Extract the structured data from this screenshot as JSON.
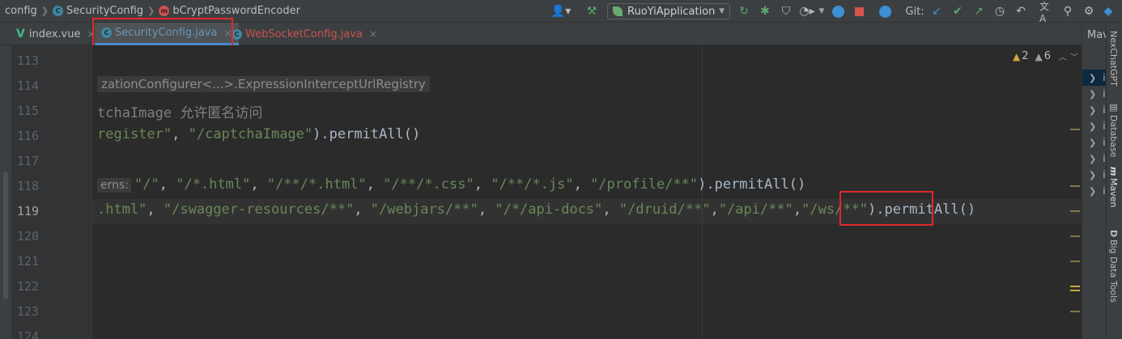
{
  "breadcrumb": {
    "items": [
      "config",
      "SecurityConfig",
      "bCryptPasswordEncoder"
    ]
  },
  "toolbar": {
    "run_config": "RuoYiApplication",
    "git_label": "Git:"
  },
  "tabs": [
    {
      "label": "index.vue",
      "icon": "vue-icon",
      "active": false,
      "color": "#bbbbbb"
    },
    {
      "label": "SecurityConfig.java",
      "icon": "class-icon",
      "active": true,
      "color": "#6897bb"
    },
    {
      "label": "WebSocketConfig.java",
      "icon": "class-icon",
      "active": false,
      "color": "#c75450"
    }
  ],
  "inspections": {
    "warnings": "2",
    "weak_warnings": "6"
  },
  "editor": {
    "line_numbers": [
      "113",
      "114",
      "115",
      "116",
      "117",
      "118",
      "119",
      "120",
      "121",
      "122",
      "123",
      "124"
    ],
    "current_line": "119",
    "lines": {
      "l114_hint": "zationConfigurer<...>.ExpressionInterceptUrlRegistry",
      "l115_comment": "tchaImage 允许匿名访问",
      "l116_s1": "register\"",
      "l116_s2": "\"/captchaImage\"",
      "l116_rest": ").permitAll()",
      "l118_hint": "erns:",
      "l118_s1": "\"/\"",
      "l118_s2": "\"/*.html\"",
      "l118_s3": "\"/**/*.html\"",
      "l118_s4": "\"/**/*.css\"",
      "l118_s5": "\"/**/*.js\"",
      "l118_s6": "\"/profile/**\"",
      "l118_rest": ").permitAll()",
      "l119_s0": ".html\"",
      "l119_s1": "\"/swagger-resources/**\"",
      "l119_s2": "\"/webjars/**\"",
      "l119_s3": "\"/*/api-docs\"",
      "l119_s4": "\"/druid/**\"",
      "l119_s5": "\"/api/**\"",
      "l119_s6": "\"/ws/**\"",
      "l119_rest": ").permitAll()"
    }
  },
  "panels": {
    "maven_title": "Mav",
    "right_strip": [
      "NexChatGPT",
      "Database",
      "Maven",
      "Big Data Tools"
    ]
  },
  "colors": {
    "accent": "#4a88c7",
    "highlight_box": "#e0282e",
    "string": "#6a8759",
    "comment": "#808080"
  }
}
